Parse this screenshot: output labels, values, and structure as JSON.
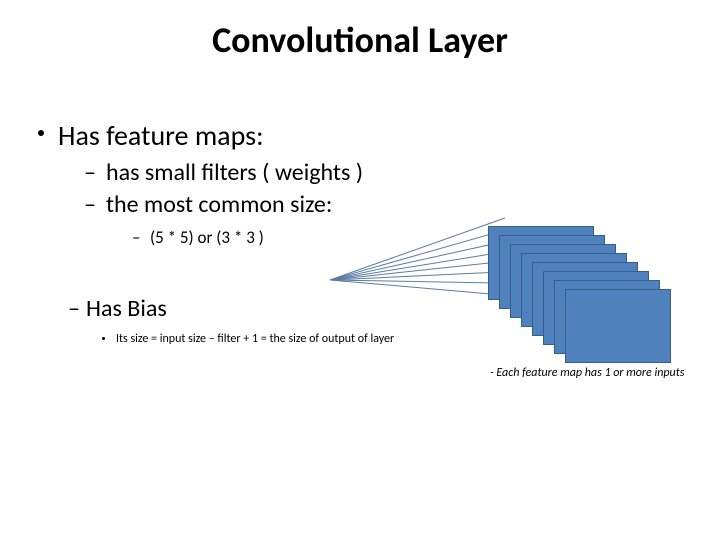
{
  "title": "Convolutional Layer",
  "bullet1": "Has feature maps:",
  "sub1": "has small filters ( weights )",
  "sub2": "the most common size:",
  "subsub1": "(5 * 5) or (3 * 3 )",
  "bullet2": "Has Bias",
  "bias_note": "Its size = input size – filter + 1  = the size of output of  layer",
  "caption": "- Each feature map has 1 or more inputs",
  "colors": {
    "card_fill": "#4f81bd",
    "card_border": "#385d8a"
  }
}
